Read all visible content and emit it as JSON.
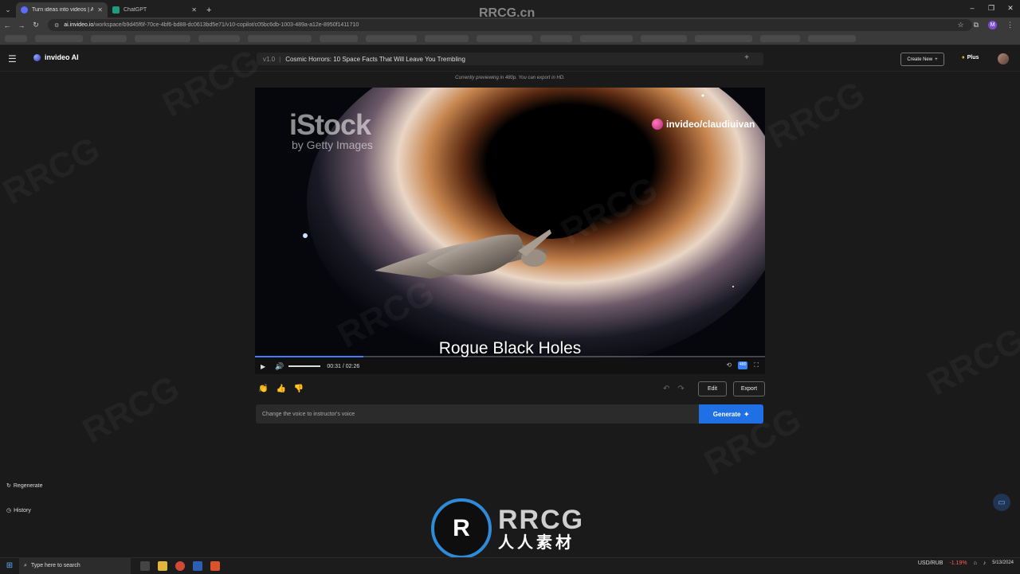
{
  "browser": {
    "tabs": [
      {
        "title": "Turn ideas into videos | AI vide",
        "active": true
      },
      {
        "title": "ChatGPT",
        "active": false
      }
    ],
    "url_host": "ai.invideo.io",
    "url_path": "/workspace/b9d45f6f-70ce-4bf6-bd88-dc0613bd5e71/v10-copilot/c05bc6db-1003-489a-a12e-8950f1411710",
    "profile_initial": "M"
  },
  "app": {
    "brand": "invideo AI",
    "version": "v1.0",
    "project_title": "Cosmic Horrors: 10 Space Facts That Will Leave You Trembling",
    "create_new_label": "Create New",
    "plan_label": "Plus",
    "preview_note": "Currently previewing in 480p. You can export in HD."
  },
  "video": {
    "watermark_brand": "iStock",
    "watermark_sub": "by Getty Images",
    "creator_handle": "invideo/claudiuivan",
    "caption": "Rogue Black Holes",
    "time_display": "00:31 / 02:26",
    "progress": 0.212,
    "quality_badge": "480"
  },
  "actions": {
    "edit_label": "Edit",
    "export_label": "Export",
    "prompt_value": "Change the voice to instructor's voice",
    "generate_label": "Generate"
  },
  "sidebar": {
    "regenerate_label": "Regenerate",
    "history_label": "History"
  },
  "overlay": {
    "rrcg_top": "RRCG.cn",
    "rrcg_logo_text": "RRCG",
    "rrcg_logo_sub": "人人素材"
  },
  "taskbar": {
    "search_placeholder": "Type here to search",
    "currency_label": "USD/RUB",
    "currency_change": "-1.19%",
    "date": "5/13/2024"
  },
  "colors": {
    "accent": "#1f6fe5",
    "progress": "#3b82f6"
  }
}
